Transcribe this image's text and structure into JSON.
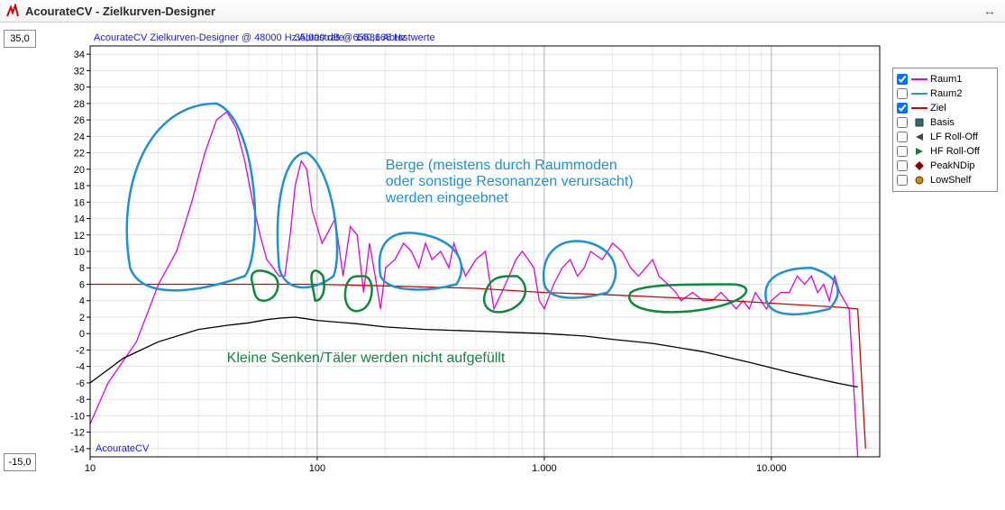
{
  "window": {
    "title": "AcourateCV - Zielkurven-Designer"
  },
  "axis_boxes": {
    "ymax": "35,0",
    "ymin": "-15,0"
  },
  "header": {
    "line": "AcourateCV Zielkurven-Designer @ 48000 Hz Abtastrate - 65536 Abtastwerte",
    "cursor": "35,000 dB @ 140,166 Hz"
  },
  "watermark": "AcourateCV",
  "annotations": {
    "blue_l1": "Berge (meistens durch Raummoden",
    "blue_l2": "oder sonstige Resonanzen verursacht)",
    "blue_l3": "werden eingeebnet",
    "green": "Kleine Senken/Täler werden nicht aufgefüllt"
  },
  "legend": {
    "items": [
      {
        "key": "raum1",
        "label": "Raum1",
        "checked": true,
        "color": "#e100e1",
        "type": "line"
      },
      {
        "key": "raum2",
        "label": "Raum2",
        "checked": false,
        "color": "#19a8b8",
        "type": "line"
      },
      {
        "key": "ziel",
        "label": "Ziel",
        "checked": true,
        "color": "#d40000",
        "type": "line"
      },
      {
        "key": "basis",
        "label": "Basis",
        "checked": false,
        "color": "#2a6b6b",
        "type": "square"
      },
      {
        "key": "lfroll",
        "label": "LF Roll-Off",
        "checked": false,
        "color": "#444",
        "type": "tri-left"
      },
      {
        "key": "hfroll",
        "label": "HF Roll-Off",
        "checked": false,
        "color": "#1a7a3a",
        "type": "tri-right"
      },
      {
        "key": "peakndip",
        "label": "PeakNDip",
        "checked": false,
        "color": "#8b0000",
        "type": "diamond"
      },
      {
        "key": "lowshelf",
        "label": "LowShelf",
        "checked": false,
        "color": "#d98b00",
        "type": "circle"
      }
    ]
  },
  "chart_data": {
    "type": "line",
    "title": "AcourateCV Zielkurven-Designer @ 48000 Hz Abtastrate - 65536 Abtastwerte",
    "xlabel": "",
    "ylabel": "",
    "xscale": "log",
    "xlim": [
      10,
      30000
    ],
    "ylim": [
      -15,
      35
    ],
    "xticks": [
      10,
      100,
      1000,
      10000
    ],
    "xtick_labels": [
      "10",
      "100",
      "1.000",
      "10.000"
    ],
    "yticks": [
      -14,
      -12,
      -10,
      -8,
      -6,
      -4,
      -2,
      0,
      2,
      4,
      6,
      8,
      10,
      12,
      14,
      16,
      18,
      20,
      22,
      24,
      26,
      28,
      30,
      32,
      34
    ],
    "series": [
      {
        "name": "Raum1",
        "color": "#e100e1",
        "x": [
          10,
          12,
          16,
          20,
          24,
          28,
          32,
          36,
          40,
          44,
          48,
          52,
          56,
          60,
          64,
          68,
          72,
          76,
          80,
          85,
          90,
          95,
          100,
          105,
          110,
          120,
          130,
          140,
          150,
          160,
          170,
          180,
          190,
          200,
          220,
          240,
          260,
          280,
          300,
          320,
          350,
          380,
          400,
          450,
          500,
          550,
          600,
          650,
          700,
          750,
          800,
          850,
          900,
          950,
          1000,
          1100,
          1200,
          1300,
          1400,
          1500,
          1600,
          1800,
          2000,
          2200,
          2400,
          2600,
          2800,
          3000,
          3200,
          3500,
          3800,
          4000,
          4500,
          5000,
          5500,
          6000,
          6500,
          7000,
          7500,
          8000,
          8500,
          9000,
          9500,
          10000,
          11000,
          12000,
          13000,
          14000,
          15000,
          16000,
          17000,
          18000,
          19000,
          20000,
          22000,
          24000
        ],
        "y": [
          -11,
          -6,
          -1,
          6,
          10,
          16,
          22,
          26,
          27,
          25,
          21,
          16,
          12,
          9,
          8,
          7,
          7,
          12,
          18,
          21,
          20,
          15,
          13,
          11,
          12,
          14,
          7,
          13,
          12,
          5,
          11,
          7,
          3,
          8,
          9,
          11,
          10,
          8,
          11,
          9,
          10,
          8,
          11,
          7,
          9,
          10,
          3,
          5,
          7,
          9,
          10,
          9,
          8,
          4,
          3,
          6,
          8,
          9,
          7,
          8,
          10,
          9,
          11,
          10,
          8,
          7,
          8,
          9,
          7,
          6,
          5,
          4,
          5,
          4,
          4,
          5,
          4,
          3,
          4,
          3,
          5,
          4,
          3,
          4,
          5,
          5,
          7,
          6,
          7,
          5,
          6,
          4,
          7,
          5,
          3,
          -15
        ]
      },
      {
        "name": "Ziel",
        "color": "#d40000",
        "x": [
          10,
          20,
          50,
          100,
          200,
          500,
          1000,
          2000,
          5000,
          10000,
          20000,
          24000,
          26000
        ],
        "y": [
          6,
          6,
          6,
          6,
          5.8,
          5.5,
          5,
          4.7,
          4.2,
          3.7,
          3.2,
          3,
          -14
        ]
      },
      {
        "name": "Basis",
        "color": "#000000",
        "x": [
          10,
          14,
          20,
          30,
          40,
          50,
          60,
          70,
          80,
          90,
          100,
          150,
          200,
          300,
          500,
          800,
          1000,
          1500,
          2000,
          3000,
          5000,
          8000,
          12000,
          16000,
          20000,
          24000
        ],
        "y": [
          -6,
          -3,
          -1,
          0.5,
          1,
          1.3,
          1.7,
          1.9,
          2,
          1.8,
          1.6,
          1.2,
          0.8,
          0.5,
          0.3,
          0.1,
          0,
          -0.3,
          -0.7,
          -1.2,
          -2.2,
          -3.5,
          -4.7,
          -5.5,
          -6.1,
          -6.5
        ]
      }
    ],
    "annotations": [
      {
        "text": "Berge (meistens durch Raummoden oder sonstige Resonanzen verursacht) werden eingeebnet",
        "color": "#1e90d8"
      },
      {
        "text": "Kleine Senken/Täler werden nicht aufgefüllt",
        "color": "#0b8a3a"
      }
    ]
  }
}
